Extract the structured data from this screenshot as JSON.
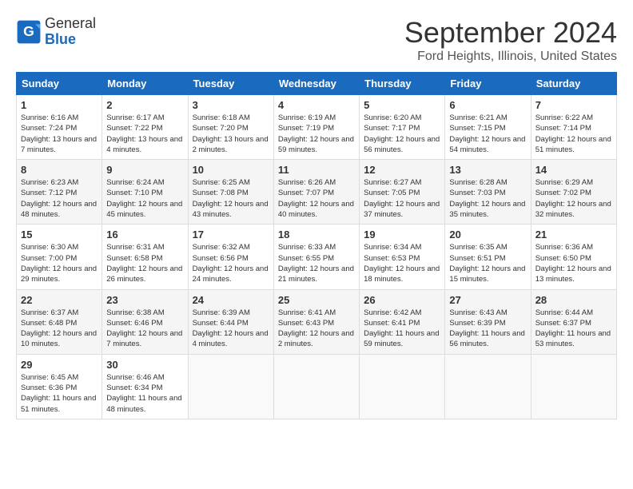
{
  "header": {
    "logo_general": "General",
    "logo_blue": "Blue",
    "month": "September 2024",
    "location": "Ford Heights, Illinois, United States"
  },
  "calendar": {
    "days_of_week": [
      "Sunday",
      "Monday",
      "Tuesday",
      "Wednesday",
      "Thursday",
      "Friday",
      "Saturday"
    ],
    "weeks": [
      [
        {
          "day": "1",
          "sunrise": "6:16 AM",
          "sunset": "7:24 PM",
          "daylight": "13 hours and 7 minutes."
        },
        {
          "day": "2",
          "sunrise": "6:17 AM",
          "sunset": "7:22 PM",
          "daylight": "13 hours and 4 minutes."
        },
        {
          "day": "3",
          "sunrise": "6:18 AM",
          "sunset": "7:20 PM",
          "daylight": "13 hours and 2 minutes."
        },
        {
          "day": "4",
          "sunrise": "6:19 AM",
          "sunset": "7:19 PM",
          "daylight": "12 hours and 59 minutes."
        },
        {
          "day": "5",
          "sunrise": "6:20 AM",
          "sunset": "7:17 PM",
          "daylight": "12 hours and 56 minutes."
        },
        {
          "day": "6",
          "sunrise": "6:21 AM",
          "sunset": "7:15 PM",
          "daylight": "12 hours and 54 minutes."
        },
        {
          "day": "7",
          "sunrise": "6:22 AM",
          "sunset": "7:14 PM",
          "daylight": "12 hours and 51 minutes."
        }
      ],
      [
        {
          "day": "8",
          "sunrise": "6:23 AM",
          "sunset": "7:12 PM",
          "daylight": "12 hours and 48 minutes."
        },
        {
          "day": "9",
          "sunrise": "6:24 AM",
          "sunset": "7:10 PM",
          "daylight": "12 hours and 45 minutes."
        },
        {
          "day": "10",
          "sunrise": "6:25 AM",
          "sunset": "7:08 PM",
          "daylight": "12 hours and 43 minutes."
        },
        {
          "day": "11",
          "sunrise": "6:26 AM",
          "sunset": "7:07 PM",
          "daylight": "12 hours and 40 minutes."
        },
        {
          "day": "12",
          "sunrise": "6:27 AM",
          "sunset": "7:05 PM",
          "daylight": "12 hours and 37 minutes."
        },
        {
          "day": "13",
          "sunrise": "6:28 AM",
          "sunset": "7:03 PM",
          "daylight": "12 hours and 35 minutes."
        },
        {
          "day": "14",
          "sunrise": "6:29 AM",
          "sunset": "7:02 PM",
          "daylight": "12 hours and 32 minutes."
        }
      ],
      [
        {
          "day": "15",
          "sunrise": "6:30 AM",
          "sunset": "7:00 PM",
          "daylight": "12 hours and 29 minutes."
        },
        {
          "day": "16",
          "sunrise": "6:31 AM",
          "sunset": "6:58 PM",
          "daylight": "12 hours and 26 minutes."
        },
        {
          "day": "17",
          "sunrise": "6:32 AM",
          "sunset": "6:56 PM",
          "daylight": "12 hours and 24 minutes."
        },
        {
          "day": "18",
          "sunrise": "6:33 AM",
          "sunset": "6:55 PM",
          "daylight": "12 hours and 21 minutes."
        },
        {
          "day": "19",
          "sunrise": "6:34 AM",
          "sunset": "6:53 PM",
          "daylight": "12 hours and 18 minutes."
        },
        {
          "day": "20",
          "sunrise": "6:35 AM",
          "sunset": "6:51 PM",
          "daylight": "12 hours and 15 minutes."
        },
        {
          "day": "21",
          "sunrise": "6:36 AM",
          "sunset": "6:50 PM",
          "daylight": "12 hours and 13 minutes."
        }
      ],
      [
        {
          "day": "22",
          "sunrise": "6:37 AM",
          "sunset": "6:48 PM",
          "daylight": "12 hours and 10 minutes."
        },
        {
          "day": "23",
          "sunrise": "6:38 AM",
          "sunset": "6:46 PM",
          "daylight": "12 hours and 7 minutes."
        },
        {
          "day": "24",
          "sunrise": "6:39 AM",
          "sunset": "6:44 PM",
          "daylight": "12 hours and 4 minutes."
        },
        {
          "day": "25",
          "sunrise": "6:41 AM",
          "sunset": "6:43 PM",
          "daylight": "12 hours and 2 minutes."
        },
        {
          "day": "26",
          "sunrise": "6:42 AM",
          "sunset": "6:41 PM",
          "daylight": "11 hours and 59 minutes."
        },
        {
          "day": "27",
          "sunrise": "6:43 AM",
          "sunset": "6:39 PM",
          "daylight": "11 hours and 56 minutes."
        },
        {
          "day": "28",
          "sunrise": "6:44 AM",
          "sunset": "6:37 PM",
          "daylight": "11 hours and 53 minutes."
        }
      ],
      [
        {
          "day": "29",
          "sunrise": "6:45 AM",
          "sunset": "6:36 PM",
          "daylight": "11 hours and 51 minutes."
        },
        {
          "day": "30",
          "sunrise": "6:46 AM",
          "sunset": "6:34 PM",
          "daylight": "11 hours and 48 minutes."
        },
        null,
        null,
        null,
        null,
        null
      ]
    ]
  }
}
